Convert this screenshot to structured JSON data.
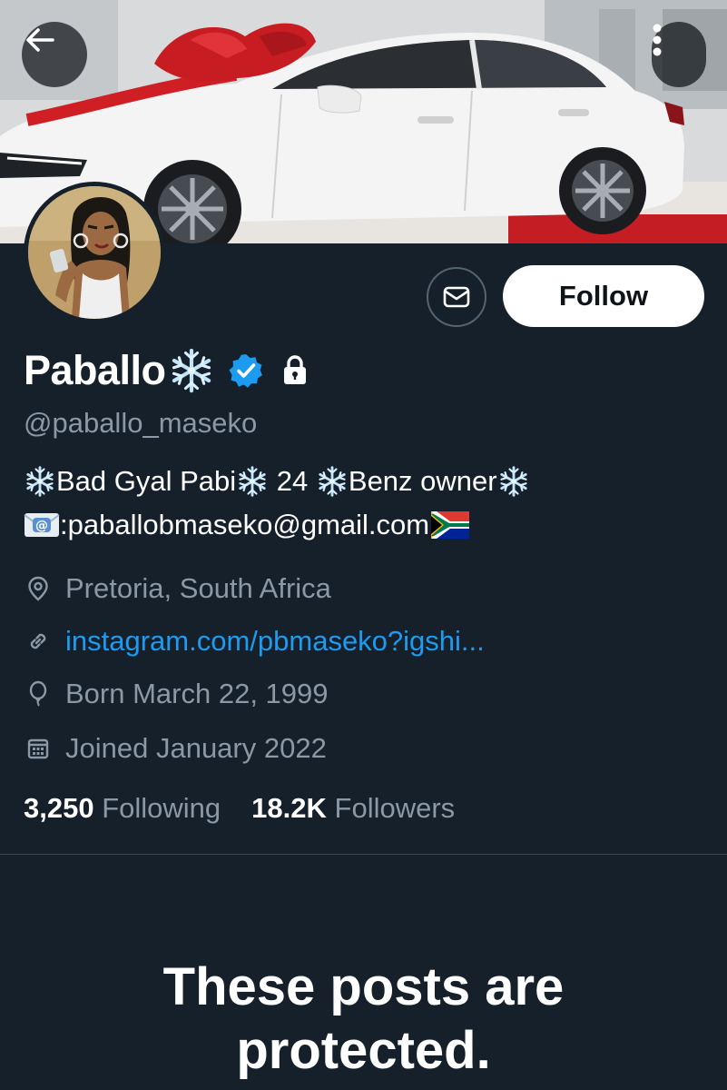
{
  "profile": {
    "display_name": "Paballo",
    "handle": "@paballo_maseko",
    "bio_line1": [
      {
        "type": "snow"
      },
      {
        "type": "text",
        "value": "Bad Gyal Pabi"
      },
      {
        "type": "snow"
      },
      {
        "type": "text",
        "value": " 24 "
      },
      {
        "type": "snow"
      },
      {
        "type": "text",
        "value": "Benz owner"
      },
      {
        "type": "snow"
      }
    ],
    "bio_line2_email": ":paballobmaseko@gmail.com",
    "location": "Pretoria, South Africa",
    "website": "instagram.com/pbmaseko?igshi...",
    "born": "Born March 22, 1999",
    "joined": "Joined January 2022",
    "following_count": "3,250",
    "following_label": "Following",
    "followers_count": "18.2K",
    "followers_label": "Followers",
    "verified": true,
    "protected": true
  },
  "actions": {
    "follow_label": "Follow"
  },
  "protected_notice": {
    "line1": "These posts are",
    "line2": "protected."
  },
  "icons": {
    "back": "arrow-left-icon",
    "more": "more-vertical-icon",
    "message": "envelope-icon",
    "verified": "verified-badge-icon",
    "lock": "lock-icon",
    "location": "location-pin-icon",
    "link": "link-icon",
    "birthday": "balloon-icon",
    "calendar": "calendar-icon",
    "snowflake": "snowflake-emoji",
    "envelope_emoji": "envelope-arrow-emoji",
    "flag": "south-africa-flag-emoji"
  },
  "colors": {
    "background": "#15202b",
    "secondary_text": "#8b98a5",
    "link": "#1d9bf0",
    "verified": "#1d9bf0",
    "divider": "#38444d",
    "follow_bg": "#ffffff"
  }
}
